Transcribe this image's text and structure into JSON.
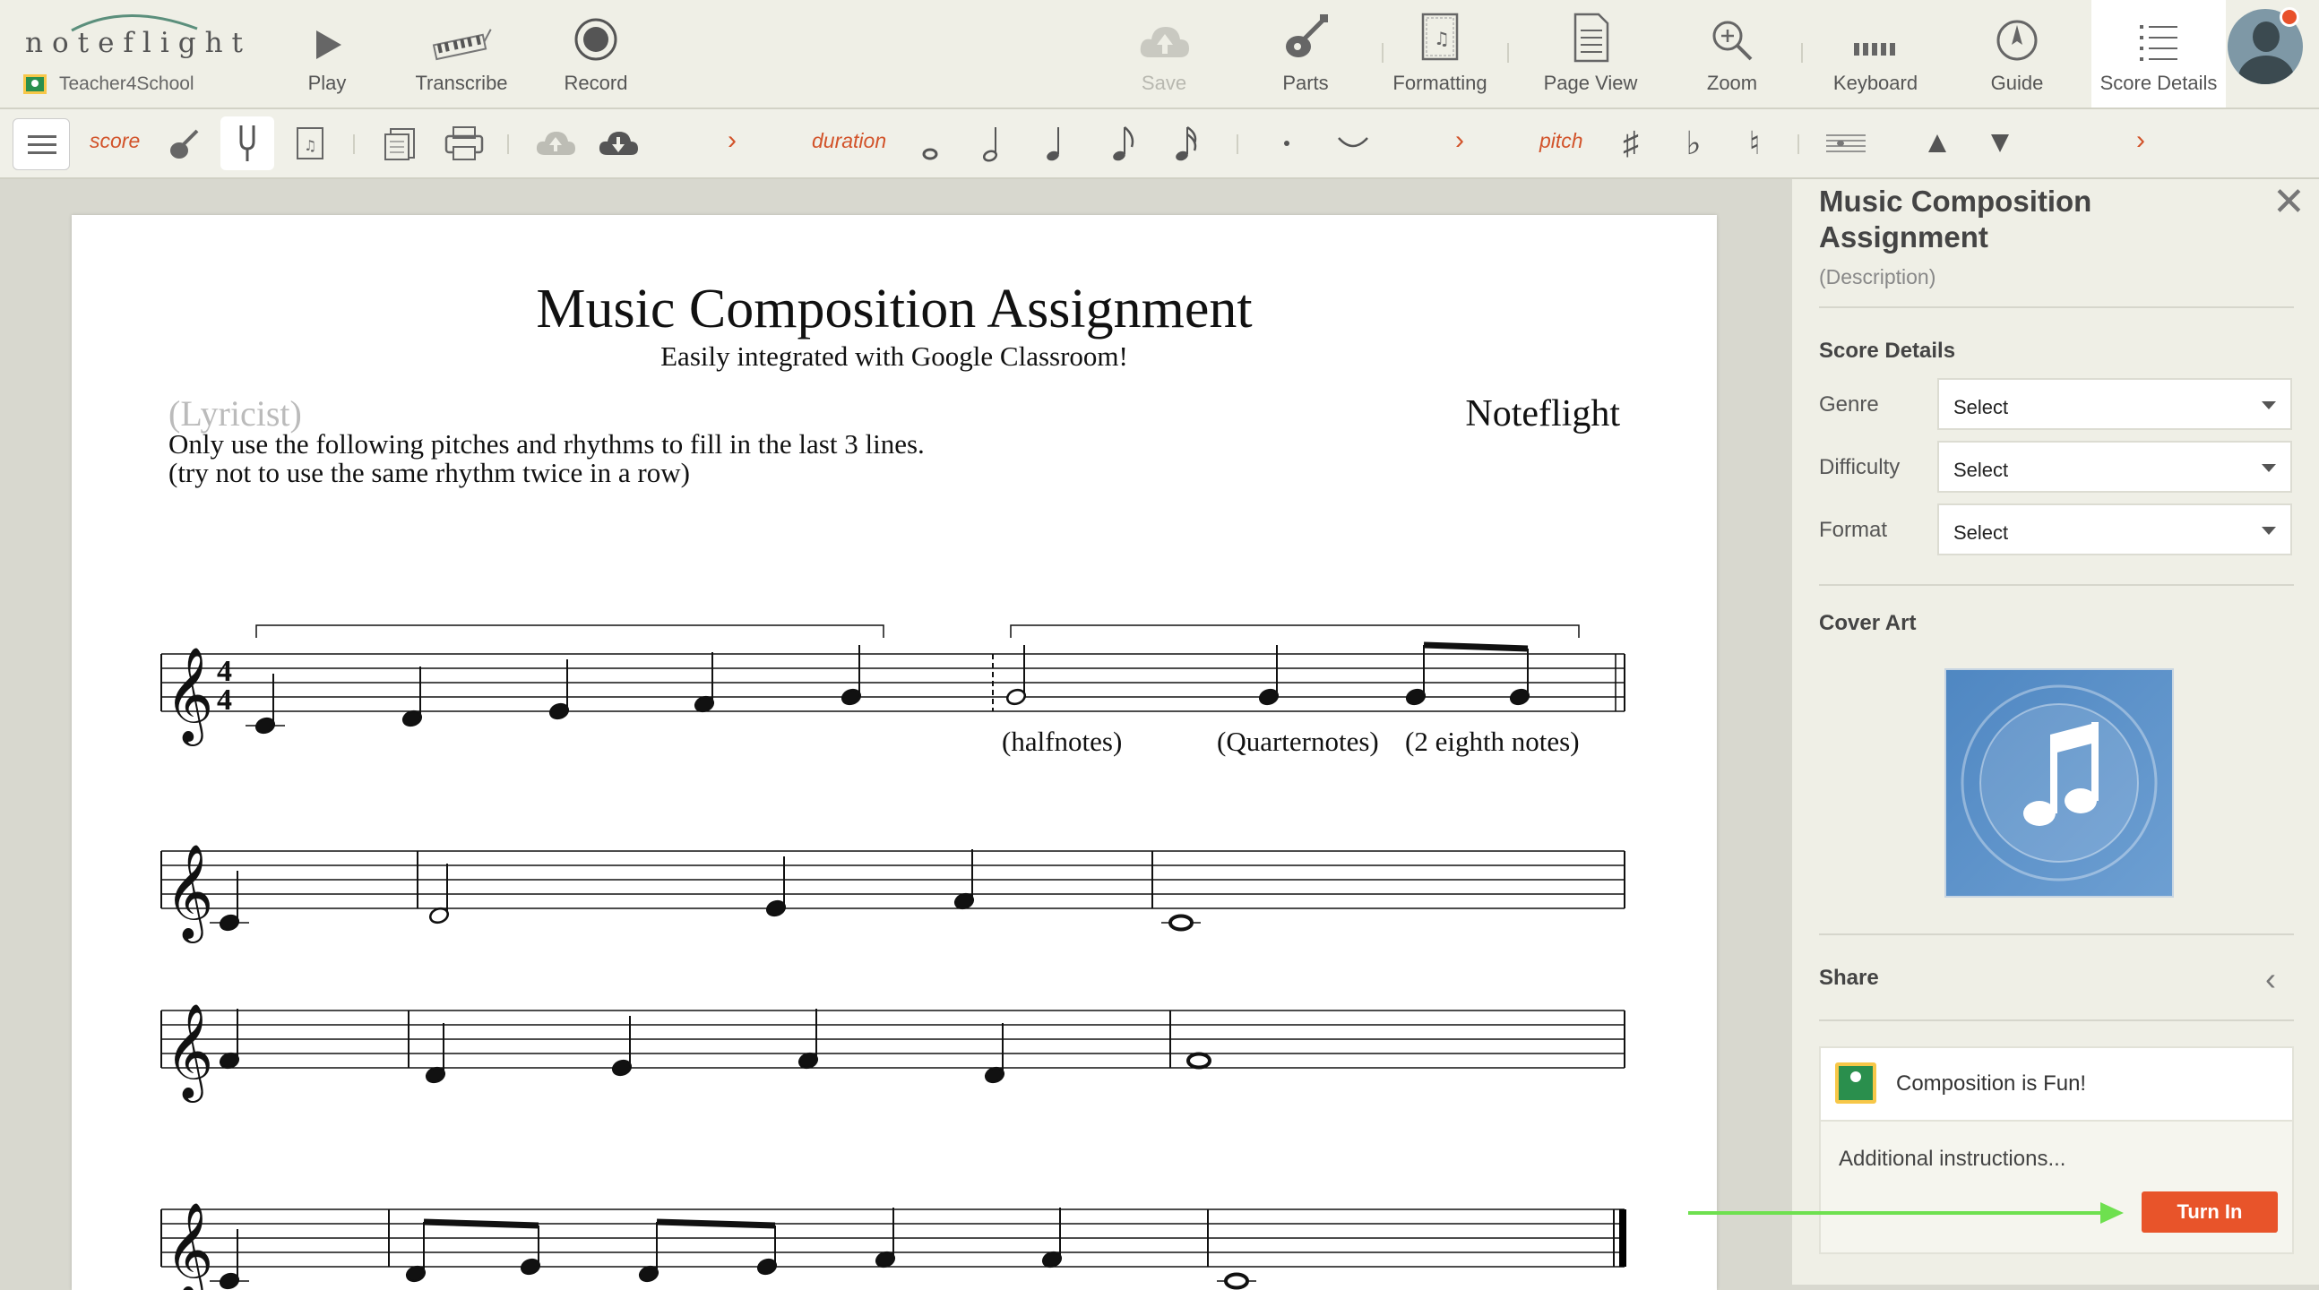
{
  "app": {
    "logo": "noteflight",
    "account": "Teacher4School"
  },
  "toolbar": {
    "buttons": [
      {
        "label": "Play",
        "icon": "play-icon"
      },
      {
        "label": "Transcribe",
        "icon": "piano-keys-icon"
      },
      {
        "label": "Record",
        "icon": "record-icon"
      },
      {
        "label": "Save",
        "icon": "cloud-upload-icon",
        "disabled": true
      },
      {
        "label": "Parts",
        "icon": "guitar-icon"
      },
      {
        "label": "Formatting",
        "icon": "formatting-icon"
      },
      {
        "label": "Page View",
        "icon": "page-icon"
      },
      {
        "label": "Zoom",
        "icon": "zoom-icon"
      },
      {
        "label": "Keyboard",
        "icon": "keyboard-icon"
      },
      {
        "label": "Guide",
        "icon": "compass-icon"
      },
      {
        "label": "Score Details",
        "icon": "list-icon",
        "active": true
      }
    ]
  },
  "subtoolbar": {
    "score_label": "score",
    "duration_label": "duration",
    "pitch_label": "pitch"
  },
  "score": {
    "title": "Music Composition Assignment",
    "subtitle": "Easily integrated with Google Classroom!",
    "lyricist": "(Lyricist)",
    "composer": "Noteflight",
    "instruction_1": "Only use the following pitches and rhythms to fill in the last 3 lines.",
    "instruction_2": "(try not to use the same rhythm twice in a row)",
    "annotations": {
      "halfnotes": "(halfnotes)",
      "quarternotes": "(Quarternotes)",
      "eighths": "(2 eighth notes)"
    },
    "time_signature": "4/4"
  },
  "panel": {
    "title": "Music Composition Assignment",
    "description": "(Description)",
    "score_details_heading": "Score Details",
    "fields": [
      {
        "label": "Genre",
        "value": "Select"
      },
      {
        "label": "Difficulty",
        "value": "Select"
      },
      {
        "label": "Format",
        "value": "Select"
      }
    ],
    "cover_art_heading": "Cover Art",
    "share_heading": "Share",
    "assignment_name": "Composition is Fun!",
    "additional_instructions": "Additional instructions...",
    "turn_in_label": "Turn In"
  },
  "colors": {
    "accent": "#e8542a",
    "arrow": "#6ee04f",
    "cover_art": "#5b90c8"
  }
}
